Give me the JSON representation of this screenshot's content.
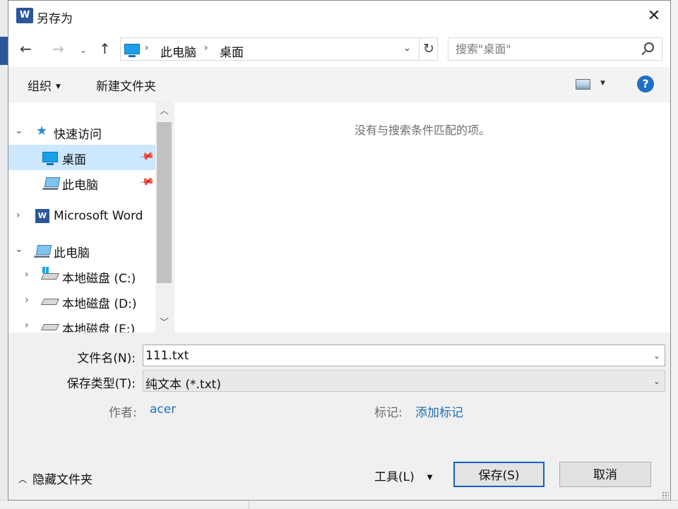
{
  "window": {
    "title": "另存为",
    "logo_letter": "W",
    "close_glyph": "✕"
  },
  "nav": {
    "back_glyph": "←",
    "forward_glyph": "→",
    "recent_glyph": "⌄",
    "up_glyph": "↑",
    "breadcrumb": [
      "此电脑",
      "桌面"
    ],
    "crumb_sep": "›",
    "address_dropdown_glyph": "⌄",
    "refresh_glyph": "↻"
  },
  "search": {
    "placeholder": "搜索\"桌面\""
  },
  "toolbar": {
    "organize_label": "组织",
    "organize_caret": "▼",
    "new_folder_label": "新建文件夹",
    "view_caret": "▼",
    "help_glyph": "?"
  },
  "navpane": {
    "items": [
      {
        "label": "快速访问",
        "chevron": "⌄",
        "icon": "star-icon"
      },
      {
        "label": "桌面",
        "icon": "desktop-icon",
        "pinned": true,
        "selected": true,
        "pin_glyph": "📌"
      },
      {
        "label": "此电脑",
        "icon": "computer-icon",
        "pinned": true,
        "pin_glyph": "📌"
      },
      {
        "label": "Microsoft Word",
        "chevron": "›",
        "icon": "word-icon"
      },
      {
        "label": "此电脑",
        "chevron": "⌄",
        "icon": "computer-icon"
      },
      {
        "label": "本地磁盘 (C:)",
        "chevron": "›",
        "icon": "drive-icon"
      },
      {
        "label": "本地磁盘 (D:)",
        "chevron": "›",
        "icon": "drive-icon"
      },
      {
        "label": "本地磁盘 (E:)",
        "chevron": "›",
        "icon": "drive-icon"
      }
    ],
    "scroll_up_glyph": "︿",
    "scroll_down_glyph": "﹀"
  },
  "content": {
    "empty_message": "没有与搜索条件匹配的项。"
  },
  "form": {
    "filename_label": "文件名(N):",
    "filename_value": "111.txt",
    "filetype_label": "保存类型(T):",
    "filetype_value": "纯文本 (*.txt)",
    "dropdown_glyph": "⌄",
    "author_label": "作者:",
    "author_value": "acer",
    "tags_label": "标记:",
    "tags_value": "添加标记"
  },
  "footer": {
    "hide_folders_label": "隐藏文件夹",
    "hide_folders_chevron": "︿",
    "tools_label": "工具(L)",
    "tools_caret": "▼",
    "save_label": "保存(S)",
    "cancel_label": "取消"
  }
}
